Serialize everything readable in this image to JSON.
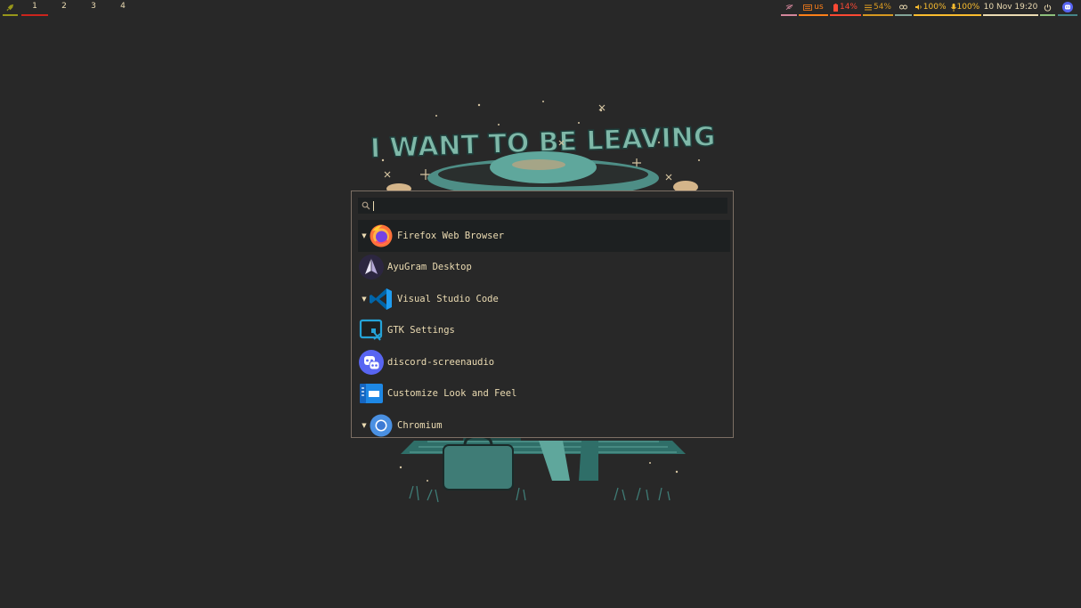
{
  "bar": {
    "workspaces": [
      "1",
      "2",
      "3",
      "4"
    ],
    "active_workspace": "1",
    "keyboard_layout": "us",
    "battery": "14%",
    "memory": "54%",
    "volume": "100%",
    "microphone": "100%",
    "clock": "10 Nov 19:20",
    "colors": {
      "launcher": "#98971a",
      "active_ws": "#cc241d",
      "network": "#d3869b",
      "keyboard": "#fe8019",
      "battery": "#fb4934",
      "memory": "#d79921",
      "link": "#83a598",
      "audio": "#fabd2f",
      "clock": "#ebdbb2",
      "power": "#8ec07c"
    }
  },
  "launcher": {
    "search_placeholder": "",
    "items": [
      {
        "label": "Firefox Web Browser",
        "icon": "firefox-icon",
        "expandable": true,
        "selected": true
      },
      {
        "label": "AyuGram Desktop",
        "icon": "ayugram-icon",
        "expandable": false,
        "selected": false
      },
      {
        "label": "Visual Studio Code",
        "icon": "vscode-icon",
        "expandable": true,
        "selected": false
      },
      {
        "label": "GTK Settings",
        "icon": "gtk-settings-icon",
        "expandable": false,
        "selected": false
      },
      {
        "label": "discord-screenaudio",
        "icon": "discord-icon",
        "expandable": false,
        "selected": false
      },
      {
        "label": "Customize Look and Feel",
        "icon": "customize-icon",
        "expandable": false,
        "selected": false
      },
      {
        "label": "Chromium",
        "icon": "chromium-icon",
        "expandable": true,
        "selected": false
      }
    ]
  },
  "wallpaper": {
    "headline": "I WANT TO BE LEAVING"
  }
}
